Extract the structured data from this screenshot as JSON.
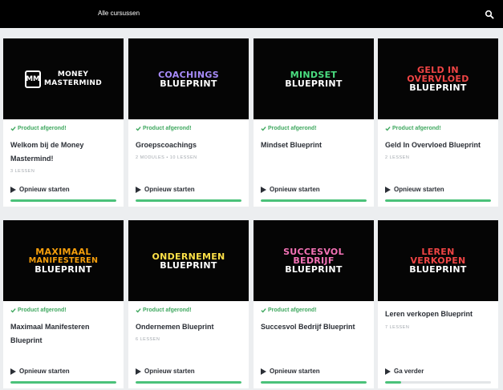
{
  "header": {
    "nav_label": "Alle cursussen",
    "search_icon": "search-icon"
  },
  "colors": {
    "accent_green": "#4bc27a",
    "status_green": "#3fa85f"
  },
  "cards": [
    {
      "logo": {
        "lines": [
          {
            "text": "MONEY",
            "color": "#ffffff"
          },
          {
            "text": "MASTERMIND",
            "color": "#ffffff"
          }
        ],
        "emblem": "MM"
      },
      "status": "Product afgerond!",
      "title": "Welkom bij de Money Mastermind!",
      "meta": "3 LESSEN",
      "action": "Opnieuw starten",
      "progress": 100
    },
    {
      "logo": {
        "lines": [
          {
            "text": "COACHINGS",
            "color": "#a78bfa"
          },
          {
            "text": "BLUEPRINT",
            "color": "#ffffff"
          }
        ]
      },
      "status": "Product afgerond!",
      "title": "Groepscoachings",
      "meta": "2 MODULES  •  10 LESSEN",
      "action": "Opnieuw starten",
      "progress": 100
    },
    {
      "logo": {
        "lines": [
          {
            "text": "MINDSET",
            "color": "#4ade80"
          },
          {
            "text": "BLUEPRINT",
            "color": "#ffffff"
          }
        ]
      },
      "status": "Product afgerond!",
      "title": "Mindset Blueprint",
      "meta": "",
      "action": "Opnieuw starten",
      "progress": 100
    },
    {
      "logo": {
        "lines": [
          {
            "text": "GELD IN",
            "color": "#ef4444"
          },
          {
            "text": "OVERVLOED",
            "color": "#ef4444"
          },
          {
            "text": "BLUEPRINT",
            "color": "#ffffff"
          }
        ]
      },
      "status": "Product afgerond!",
      "title": "Geld In Overvloed Blueprint",
      "meta": "2 LESSEN",
      "action": "Opnieuw starten",
      "progress": 100
    },
    {
      "logo": {
        "lines": [
          {
            "text": "MAXIMAAL",
            "color": "#f59e0b"
          },
          {
            "text": "MANIFESTEREN",
            "color": "#f59e0b"
          },
          {
            "text": "BLUEPRINT",
            "color": "#ffffff"
          }
        ]
      },
      "status": "Product afgerond!",
      "title": "Maximaal Manifesteren Blueprint",
      "meta": "",
      "action": "Opnieuw starten",
      "progress": 100
    },
    {
      "logo": {
        "lines": [
          {
            "text": "ONDERNEMEN",
            "color": "#fde047"
          },
          {
            "text": "BLUEPRINT",
            "color": "#ffffff"
          }
        ]
      },
      "status": "Product afgerond!",
      "title": "Ondernemen Blueprint",
      "meta": "6 LESSEN",
      "action": "Opnieuw starten",
      "progress": 100
    },
    {
      "logo": {
        "lines": [
          {
            "text": "SUCCESVOL",
            "color": "#f472b6"
          },
          {
            "text": "BEDRIJF",
            "color": "#f472b6"
          },
          {
            "text": "BLUEPRINT",
            "color": "#ffffff"
          }
        ]
      },
      "status": "Product afgerond!",
      "title": "Succesvol Bedrijf Blueprint",
      "meta": "",
      "action": "Opnieuw starten",
      "progress": 100
    },
    {
      "logo": {
        "lines": [
          {
            "text": "LEREN",
            "color": "#ef4444"
          },
          {
            "text": "VERKOPEN",
            "color": "#ef4444"
          },
          {
            "text": "BLUEPRINT",
            "color": "#ffffff"
          }
        ]
      },
      "status": "",
      "title": "Leren verkopen Blueprint",
      "meta": "7 LESSEN",
      "action": "Ga verder",
      "progress": 15
    }
  ]
}
